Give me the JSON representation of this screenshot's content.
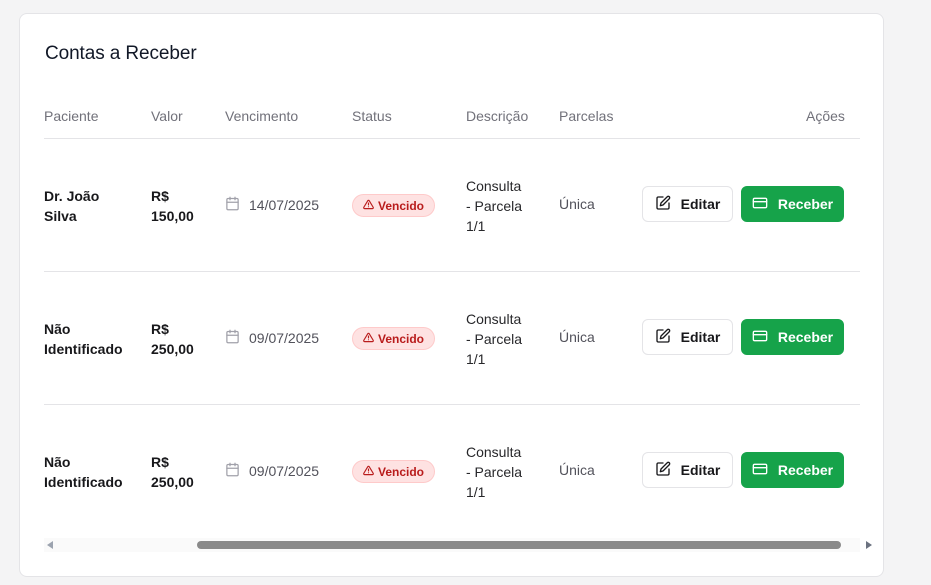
{
  "card": {
    "title": "Contas a Receber"
  },
  "table": {
    "headers": {
      "patient": "Paciente",
      "valor": "Valor",
      "vencimento": "Vencimento",
      "status": "Status",
      "descricao": "Descrição",
      "parcelas": "Parcelas",
      "acoes": "Ações"
    },
    "rows": [
      {
        "patient": "Dr. João Silva",
        "valor_line1": "R$",
        "valor_line2": "150,00",
        "vencimento": "14/07/2025",
        "status": "Vencido",
        "desc_line1": "Consulta",
        "desc_line2": "- Parcela",
        "desc_line3": "1/1",
        "parcelas": "Única",
        "edit_label": "Editar",
        "receive_label": "Receber"
      },
      {
        "patient": "Não Identificado",
        "valor_line1": "R$",
        "valor_line2": "250,00",
        "vencimento": "09/07/2025",
        "status": "Vencido",
        "desc_line1": "Consulta",
        "desc_line2": "- Parcela",
        "desc_line3": "1/1",
        "parcelas": "Única",
        "edit_label": "Editar",
        "receive_label": "Receber"
      },
      {
        "patient": "Não Identificado",
        "valor_line1": "R$",
        "valor_line2": "250,00",
        "vencimento": "09/07/2025",
        "status": "Vencido",
        "desc_line1": "Consulta",
        "desc_line2": "- Parcela",
        "desc_line3": "1/1",
        "parcelas": "Única",
        "edit_label": "Editar",
        "receive_label": "Receber"
      }
    ]
  },
  "colors": {
    "accent_green": "#16a34a",
    "status_badge_bg": "#fee2e2",
    "status_badge_text": "#b91c1c"
  },
  "icons": {
    "date": "calendar-icon",
    "status": "warning-triangle-icon",
    "edit": "edit-pencil-icon",
    "receive": "credit-card-icon"
  }
}
